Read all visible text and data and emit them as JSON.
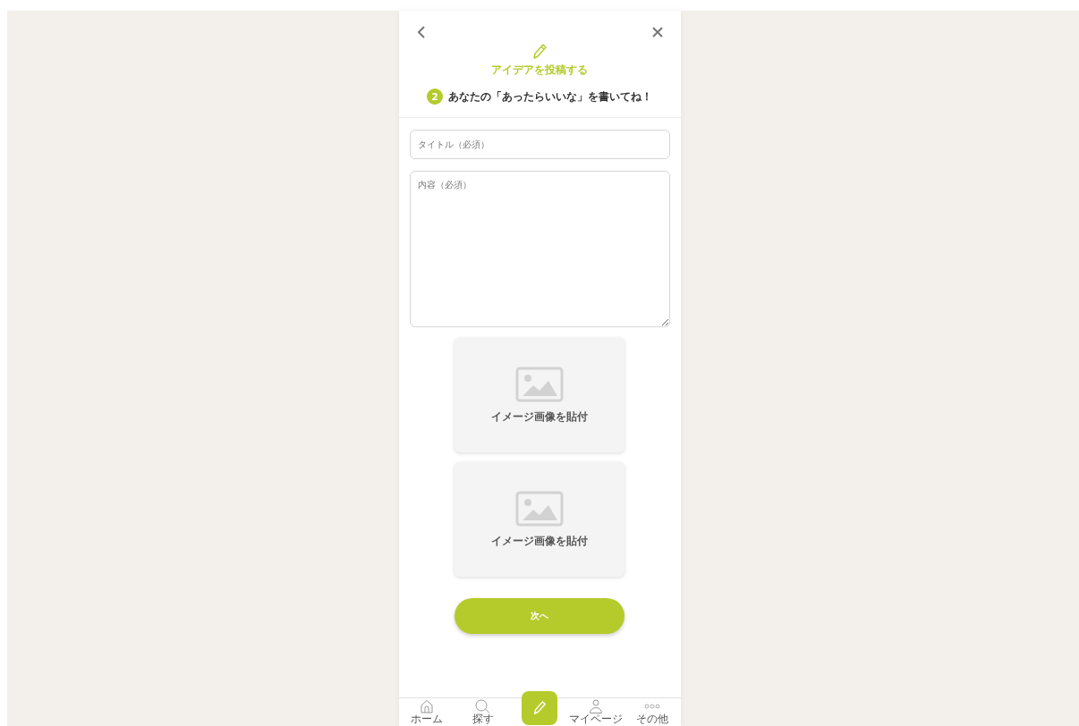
{
  "header": {
    "title": "アイデアを投稿する",
    "step": "2",
    "step_text": "あなたの「あったらいいな」を書いてね！"
  },
  "form": {
    "title_field": {
      "placeholder": "タイトル（必須）"
    },
    "content_field": {
      "placeholder": "内容（必須）"
    }
  },
  "image_slots": [
    {
      "label": "イメージ画像を貼付"
    },
    {
      "label": "イメージ画像を貼付"
    }
  ],
  "next_button": "次へ",
  "bottom_nav": [
    {
      "kind": "home",
      "label": "ホーム"
    },
    {
      "kind": "search",
      "label": "探す"
    },
    {
      "kind": "post"
    },
    {
      "kind": "user",
      "label": "マイページ"
    },
    {
      "kind": "more",
      "label": "その他"
    }
  ]
}
